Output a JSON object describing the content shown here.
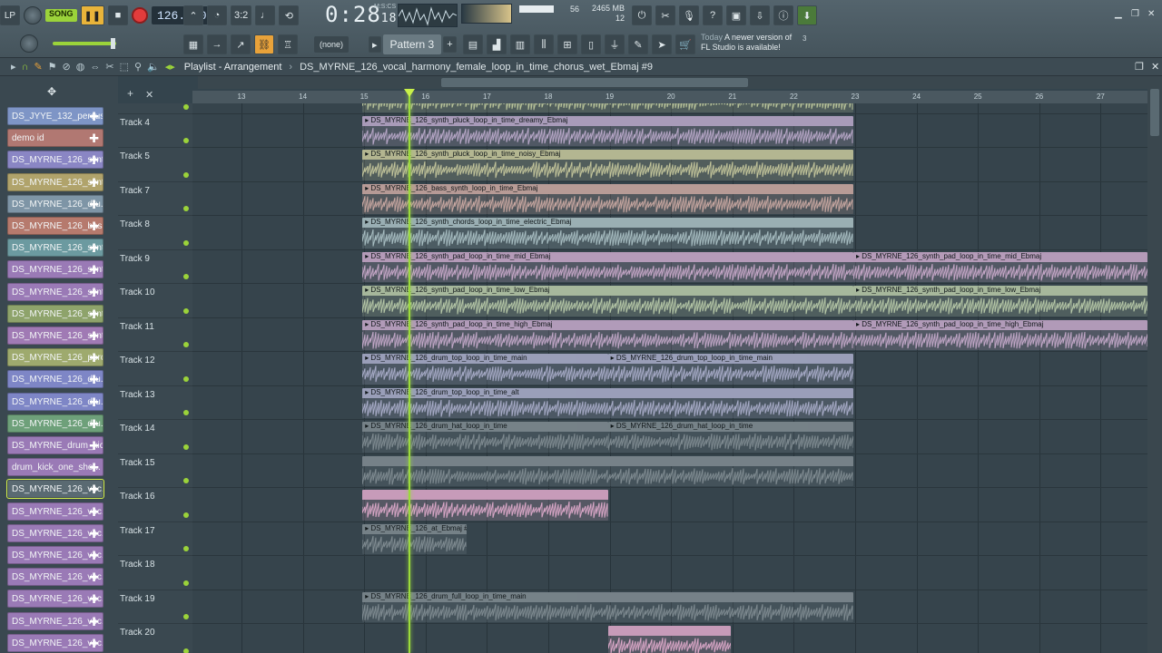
{
  "toolbar": {
    "lp_label": "LP",
    "song_label": "SONG",
    "tempo": "126.000",
    "time_main": "0:28",
    "time_sub": "18",
    "mcs_label": "M:S:CS",
    "cpu_value": "56",
    "memory": "2465 MB",
    "polyphony": "12",
    "pattern_select": "(none)",
    "pattern_name": "Pattern 3",
    "news_today": "Today",
    "news_text": "A newer version of",
    "news_text2": "FL Studio is available!",
    "news_count": "3"
  },
  "playlist": {
    "title": "Playlist - Arrangement",
    "separator": "›",
    "project": "DS_MYRNE_126_vocal_harmony_female_loop_in_time_chorus_wet_Ebmaj #9"
  },
  "ruler": {
    "bars": [
      "13",
      "14",
      "15",
      "16",
      "17",
      "18",
      "19",
      "20",
      "21",
      "22",
      "23",
      "24",
      "25",
      "26",
      "27"
    ]
  },
  "picker": [
    {
      "label": "DS_JYYE_132_percus...",
      "color": "#7e95c6"
    },
    {
      "label": "demo id",
      "color": "#b17872"
    },
    {
      "label": "DS_MYRNE_126_synt...",
      "color": "#8a86c4"
    },
    {
      "label": "DS_MYRNE_126_synt...",
      "color": "#b0a36b"
    },
    {
      "label": "DS_MYRNE_126_dru...",
      "color": "#7e95a6"
    },
    {
      "label": "DS_MYRNE_126_bass...",
      "color": "#b67a6d"
    },
    {
      "label": "DS_MYRNE_126_synt...",
      "color": "#6c9aa0"
    },
    {
      "label": "DS_MYRNE_126_synt...",
      "color": "#9a7ab6"
    },
    {
      "label": "DS_MYRNE_126_synt...",
      "color": "#9a7ab6"
    },
    {
      "label": "DS_MYRNE_126_synt...",
      "color": "#8ea36b"
    },
    {
      "label": "DS_MYRNE_126_synt...",
      "color": "#a07ab4"
    },
    {
      "label": "DS_MYRNE_126_perc...",
      "color": "#9eaa6e"
    },
    {
      "label": "DS_MYRNE_126_dru...",
      "color": "#7e86c6"
    },
    {
      "label": "DS_MYRNE_126_dru...",
      "color": "#7e86c6"
    },
    {
      "label": "DS_MYRNE_126_dru...",
      "color": "#6ea07a"
    },
    {
      "label": "DS_MYRNE_drum_kic...",
      "color": "#9a7ab6"
    },
    {
      "label": "drum_kick_one_sho...",
      "color": "#9a7ab6"
    },
    {
      "label": "DS_MYRNE_126_voc...",
      "color": "#5a6a72"
    },
    {
      "label": "DS_MYRNE_126_voc...",
      "color": "#9a7ab6"
    },
    {
      "label": "DS_MYRNE_126_voc...",
      "color": "#9a7ab6"
    },
    {
      "label": "DS_MYRNE_126_voc...",
      "color": "#9a7ab6"
    },
    {
      "label": "DS_MYRNE_126_voc...",
      "color": "#9a7ab6"
    },
    {
      "label": "DS_MYRNE_126_voc...",
      "color": "#9a7ab6"
    },
    {
      "label": "DS_MYRNE_126_voc...",
      "color": "#9a7ab6"
    },
    {
      "label": "DS_MYRNE_126_voc...",
      "color": "#9a7ab6"
    }
  ],
  "tracks": [
    {
      "name": "",
      "clips": [
        {
          "title": "",
          "start": 15,
          "end": 23,
          "color": "#b8c39a"
        }
      ]
    },
    {
      "name": "Track 4",
      "clips": [
        {
          "title": "DS_MYRNE_126_synth_pluck_loop_in_time_dreamy_Ebmaj",
          "start": 15,
          "end": 23,
          "color": "#b6a6c6"
        }
      ]
    },
    {
      "name": "Track 5",
      "clips": [
        {
          "title": "DS_MYRNE_126_synth_pluck_loop_in_time_noisy_Ebmaj",
          "start": 15,
          "end": 23,
          "color": "#c2c49a"
        }
      ]
    },
    {
      "name": "Track 7",
      "clips": [
        {
          "title": "DS_MYRNE_126_bass_synth_loop_in_time_Ebmaj",
          "start": 15,
          "end": 23,
          "color": "#c6a6a0"
        }
      ]
    },
    {
      "name": "Track 8",
      "clips": [
        {
          "title": "DS_MYRNE_126_synth_chords_loop_in_time_electric_Ebmaj",
          "start": 15,
          "end": 23,
          "color": "#a6bcc0"
        }
      ]
    },
    {
      "name": "Track 9",
      "clips": [
        {
          "title": "DS_MYRNE_126_synth_pad_loop_in_time_mid_Ebmaj",
          "start": 15,
          "end": 23,
          "color": "#c4a6c6"
        },
        {
          "title": "DS_MYRNE_126_synth_pad_loop_in_time_mid_Ebmaj",
          "start": 23,
          "end": 27.8,
          "color": "#c4a6c6"
        }
      ]
    },
    {
      "name": "Track 10",
      "clips": [
        {
          "title": "DS_MYRNE_126_synth_pad_loop_in_time_low_Ebmaj",
          "start": 15,
          "end": 23,
          "color": "#b4c6a6"
        },
        {
          "title": "DS_MYRNE_126_synth_pad_loop_in_time_low_Ebmaj",
          "start": 23,
          "end": 27.8,
          "color": "#b4c6a6"
        }
      ]
    },
    {
      "name": "Track 11",
      "clips": [
        {
          "title": "DS_MYRNE_126_synth_pad_loop_in_time_high_Ebmaj",
          "start": 15,
          "end": 23,
          "color": "#c0a6c6"
        },
        {
          "title": "DS_MYRNE_126_synth_pad_loop_in_time_high_Ebmaj",
          "start": 23,
          "end": 27.8,
          "color": "#c0a6c6"
        }
      ]
    },
    {
      "name": "Track 12",
      "clips": [
        {
          "title": "DS_MYRNE_126_drum_top_loop_in_time_main",
          "start": 15,
          "end": 19,
          "color": "#a6aac6"
        },
        {
          "title": "DS_MYRNE_126_drum_top_loop_in_time_main",
          "start": 19,
          "end": 23,
          "color": "#a6aac6"
        }
      ]
    },
    {
      "name": "Track 13",
      "clips": [
        {
          "title": "DS_MYRNE_126_drum_top_loop_in_time_alt",
          "start": 15,
          "end": 23,
          "color": "#a6aac6"
        }
      ]
    },
    {
      "name": "Track 14",
      "clips": [
        {
          "title": "DS_MYRNE_126_drum_hat_loop_in_time",
          "start": 15,
          "end": 19,
          "color": "#7e8a90"
        },
        {
          "title": "DS_MYRNE_126_drum_hat_loop_in_time",
          "start": 19,
          "end": 23,
          "color": "#7e8a90"
        }
      ]
    },
    {
      "name": "Track 15",
      "clips": [
        {
          "title": "",
          "start": 15,
          "end": 23,
          "color": "#7e8a90"
        }
      ]
    },
    {
      "name": "Track 16",
      "clips": [
        {
          "title": "",
          "start": 15,
          "end": 19,
          "color": "#d8a6c6"
        }
      ]
    },
    {
      "name": "Track 17",
      "clips": [
        {
          "title": "DS_MYRNE_126_at_Ebmaj #3",
          "start": 15,
          "end": 16.7,
          "color": "#7e8a90"
        }
      ]
    },
    {
      "name": "Track 18",
      "clips": []
    },
    {
      "name": "Track 19",
      "clips": [
        {
          "title": "DS_MYRNE_126_drum_full_loop_in_time_main",
          "start": 15,
          "end": 23,
          "color": "#7e8a90"
        }
      ]
    },
    {
      "name": "Track 20",
      "clips": [
        {
          "title": "",
          "start": 19,
          "end": 21,
          "color": "#d8a6c6"
        }
      ]
    }
  ],
  "colors": {
    "accent": "#9bd33a",
    "playhead": "#9bdb3a"
  },
  "icons": [
    "song-mode-icon",
    "play-icon",
    "stop-icon",
    "record-icon",
    "metronome-icon",
    "undo-icon",
    "save-icon",
    "help-icon",
    "link-icon",
    "minimize-icon",
    "maximize-icon",
    "close-icon"
  ]
}
